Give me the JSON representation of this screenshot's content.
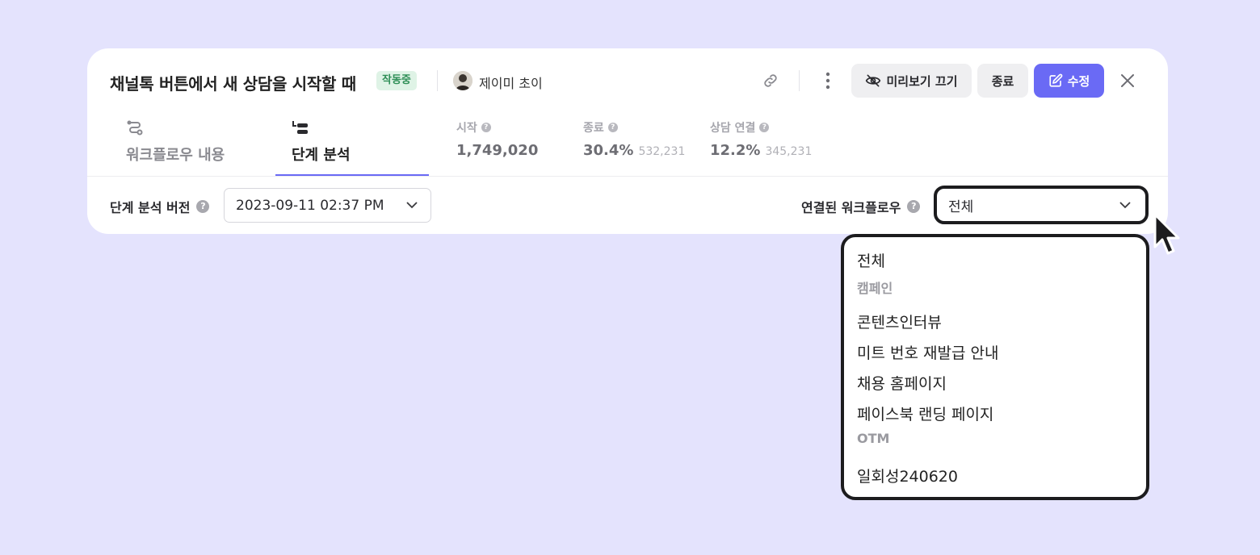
{
  "header": {
    "title": "채널톡 버튼에서 새 상담을 시작할 때",
    "status_badge": "작동중",
    "owner_name": "제이미 초이",
    "preview_off_label": "미리보기 끄기",
    "end_label": "종료",
    "edit_label": "수정"
  },
  "tabs": [
    {
      "label": "워크플로우 내용",
      "icon": "workflow-icon",
      "active": false
    },
    {
      "label": "단계 분석",
      "icon": "step-analysis-icon",
      "active": true
    }
  ],
  "stats": [
    {
      "label": "시작",
      "value": "1,749,020",
      "sub": ""
    },
    {
      "label": "종료",
      "value": "30.4%",
      "sub": "532,231"
    },
    {
      "label": "상담 연결",
      "value": "12.2%",
      "sub": "345,231"
    }
  ],
  "filters": {
    "version_label": "단계 분석 버전",
    "version_value": "2023-09-11 02:37 PM",
    "workflow_label": "연결된 워크플로우",
    "workflow_value": "전체"
  },
  "dropdown": {
    "all": "전체",
    "groups": [
      {
        "name": "캠페인",
        "items": [
          "콘텐츠인터뷰",
          "미트 번호 재발급 안내",
          "채용 홈페이지",
          "페이스북 랜딩 페이지"
        ]
      },
      {
        "name": "OTM",
        "items": [
          "일회성240620"
        ]
      }
    ]
  },
  "colors": {
    "background": "#e4e3fd",
    "accent": "#6a6af5",
    "badge_bg": "#dff3e6",
    "badge_text": "#2f8f57"
  }
}
